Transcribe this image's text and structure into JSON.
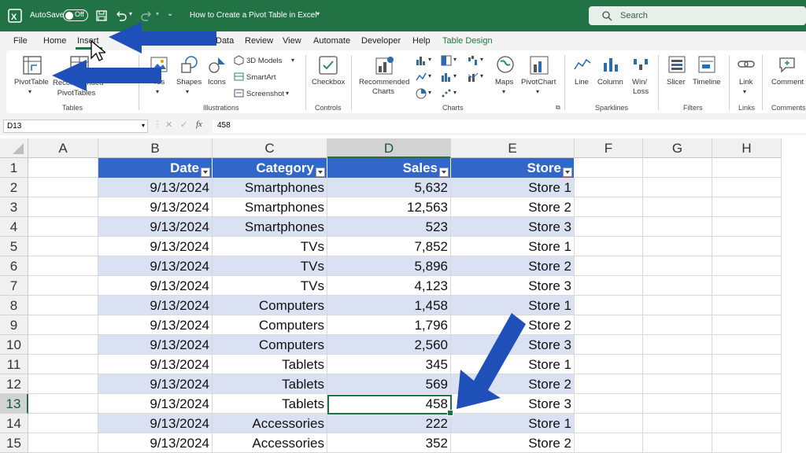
{
  "titlebar": {
    "autosave_label": "AutoSave",
    "autosave_state": "Off",
    "doc_title": "How to Create a Pivot Table in Excel",
    "search_placeholder": "Search"
  },
  "tabs": [
    "File",
    "Home",
    "Insert",
    "Data",
    "Review",
    "View",
    "Automate",
    "Developer",
    "Help",
    "Table Design"
  ],
  "ribbon": {
    "tables": {
      "pivottable": "PivotTable",
      "recommended": "Recommended PivotTables",
      "group": "Tables"
    },
    "illustrations": {
      "pictures": "Pictures",
      "shapes": "Shapes",
      "icons": "Icons",
      "models3d": "3D Models",
      "smartart": "SmartArt",
      "screenshot": "Screenshot",
      "group": "Illustrations"
    },
    "controls": {
      "checkbox": "Checkbox",
      "group": "Controls"
    },
    "charts": {
      "recommended": "Recommended",
      "recommended2": "Charts",
      "maps": "Maps",
      "pivotchart": "PivotChart",
      "group": "Charts"
    },
    "sparklines": {
      "line": "Line",
      "column": "Column",
      "winloss": "Win/",
      "winloss2": "Loss",
      "group": "Sparklines"
    },
    "filters": {
      "slicer": "Slicer",
      "timeline": "Timeline",
      "group": "Filters"
    },
    "links": {
      "link": "Link",
      "group": "Links"
    },
    "comments": {
      "comment": "Comment",
      "group": "Comments"
    }
  },
  "formula_bar": {
    "name_box": "D13",
    "fx": "fx",
    "value": "458"
  },
  "columns": [
    "A",
    "B",
    "C",
    "D",
    "E",
    "F",
    "G",
    "H"
  ],
  "table": {
    "headers": [
      "Date",
      "Category",
      "Sales",
      "Store"
    ],
    "rows": [
      {
        "row": "2",
        "date": "9/13/2024",
        "category": "Smartphones",
        "sales": "5,632",
        "store": "Store 1"
      },
      {
        "row": "3",
        "date": "9/13/2024",
        "category": "Smartphones",
        "sales": "12,563",
        "store": "Store 2"
      },
      {
        "row": "4",
        "date": "9/13/2024",
        "category": "Smartphones",
        "sales": "523",
        "store": "Store 3"
      },
      {
        "row": "5",
        "date": "9/13/2024",
        "category": "TVs",
        "sales": "7,852",
        "store": "Store 1"
      },
      {
        "row": "6",
        "date": "9/13/2024",
        "category": "TVs",
        "sales": "5,896",
        "store": "Store 2"
      },
      {
        "row": "7",
        "date": "9/13/2024",
        "category": "TVs",
        "sales": "4,123",
        "store": "Store 3"
      },
      {
        "row": "8",
        "date": "9/13/2024",
        "category": "Computers",
        "sales": "1,458",
        "store": "Store 1"
      },
      {
        "row": "9",
        "date": "9/13/2024",
        "category": "Computers",
        "sales": "1,796",
        "store": "Store 2"
      },
      {
        "row": "10",
        "date": "9/13/2024",
        "category": "Computers",
        "sales": "2,560",
        "store": "Store 3"
      },
      {
        "row": "11",
        "date": "9/13/2024",
        "category": "Tablets",
        "sales": "345",
        "store": "Store 1"
      },
      {
        "row": "12",
        "date": "9/13/2024",
        "category": "Tablets",
        "sales": "569",
        "store": "Store 2"
      },
      {
        "row": "13",
        "date": "9/13/2024",
        "category": "Tablets",
        "sales": "458",
        "store": "Store 3"
      },
      {
        "row": "14",
        "date": "9/13/2024",
        "category": "Accessories",
        "sales": "222",
        "store": "Store 1"
      },
      {
        "row": "15",
        "date": "9/13/2024",
        "category": "Accessories",
        "sales": "352",
        "store": "Store 2"
      }
    ]
  },
  "colors": {
    "excel_green": "#217346",
    "table_header": "#3266c9",
    "band": "#d9e1f2",
    "arrow": "#1f4fb8"
  }
}
